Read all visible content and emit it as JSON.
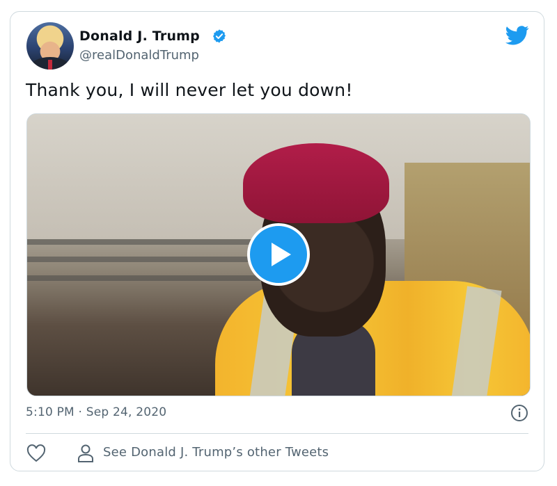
{
  "tweet": {
    "author_name": "Donald J. Trump",
    "author_handle": "@realDonaldTrump",
    "text": "Thank you, I will never let you down!",
    "timestamp": "5:10 PM · Sep 24, 2020",
    "verified": true
  },
  "footer": {
    "other_tweets_label": "See Donald J. Trump’s other Tweets"
  },
  "icons": {
    "brand": "twitter-bird-icon",
    "verified": "verified-badge-icon",
    "play": "play-icon",
    "info": "info-icon",
    "like": "heart-icon",
    "profile": "person-icon"
  },
  "colors": {
    "accent": "#1d9bf0",
    "secondary_text": "#536471",
    "border": "#cfd9de"
  }
}
